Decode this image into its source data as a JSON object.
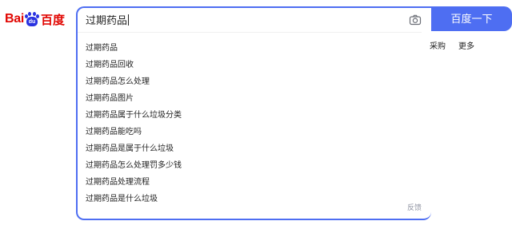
{
  "logo": {
    "latin_bai": "Bai",
    "paw_text": "du",
    "chinese": "百度"
  },
  "search": {
    "query": "过期药品",
    "camera_icon": "camera-icon",
    "suggestions": [
      "过期药品",
      "过期药品回收",
      "过期药品怎么处理",
      "过期药品图片",
      "过期药品属于什么垃圾分类",
      "过期药品能吃吗",
      "过期药品是属于什么垃圾",
      "过期药品怎么处理罚多少钱",
      "过期药品处理流程",
      "过期药品是什么垃圾"
    ],
    "feedback_label": "反馈"
  },
  "search_button_label": "百度一下",
  "right_links": [
    "采购",
    "更多"
  ],
  "colors": {
    "brand_blue": "#4e6ef2",
    "logo_red": "#e10602",
    "logo_blue": "#2932e1"
  }
}
